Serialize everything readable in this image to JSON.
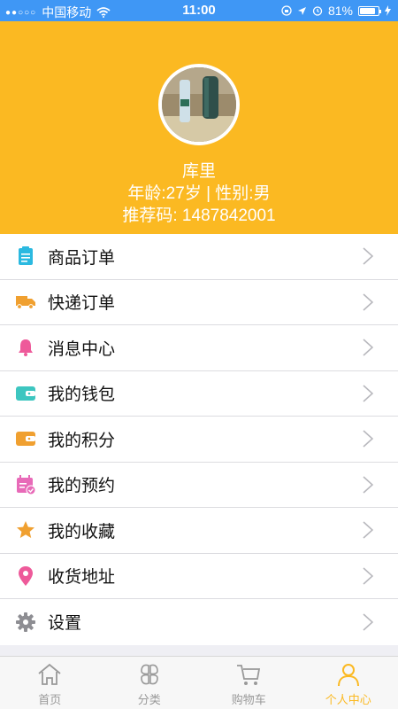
{
  "status_bar": {
    "carrier": "中国移动",
    "time": "11:00",
    "battery": "81%"
  },
  "profile": {
    "name": "库里",
    "meta": "年龄:27岁 | 性别:男",
    "referral": "推荐码:  1487842001"
  },
  "menu": [
    {
      "label": "商品订单",
      "icon": "clipboard-icon"
    },
    {
      "label": "快递订单",
      "icon": "truck-icon"
    },
    {
      "label": "消息中心",
      "icon": "bell-icon"
    },
    {
      "label": "我的钱包",
      "icon": "wallet-icon"
    },
    {
      "label": "我的积分",
      "icon": "points-wallet-icon"
    },
    {
      "label": "我的预约",
      "icon": "calendar-icon"
    },
    {
      "label": "我的收藏",
      "icon": "star-icon"
    },
    {
      "label": "收货地址",
      "icon": "location-pin-icon"
    },
    {
      "label": "设置",
      "icon": "gear-icon"
    }
  ],
  "tabs": [
    {
      "label": "首页",
      "icon": "home-icon",
      "active": false
    },
    {
      "label": "分类",
      "icon": "category-icon",
      "active": false
    },
    {
      "label": "购物车",
      "icon": "cart-icon",
      "active": false
    },
    {
      "label": "个人中心",
      "icon": "person-icon",
      "active": true
    }
  ],
  "colors": {
    "status_bar": "#3f97f5",
    "header": "#fbb922",
    "active_tab": "#fbb922"
  }
}
